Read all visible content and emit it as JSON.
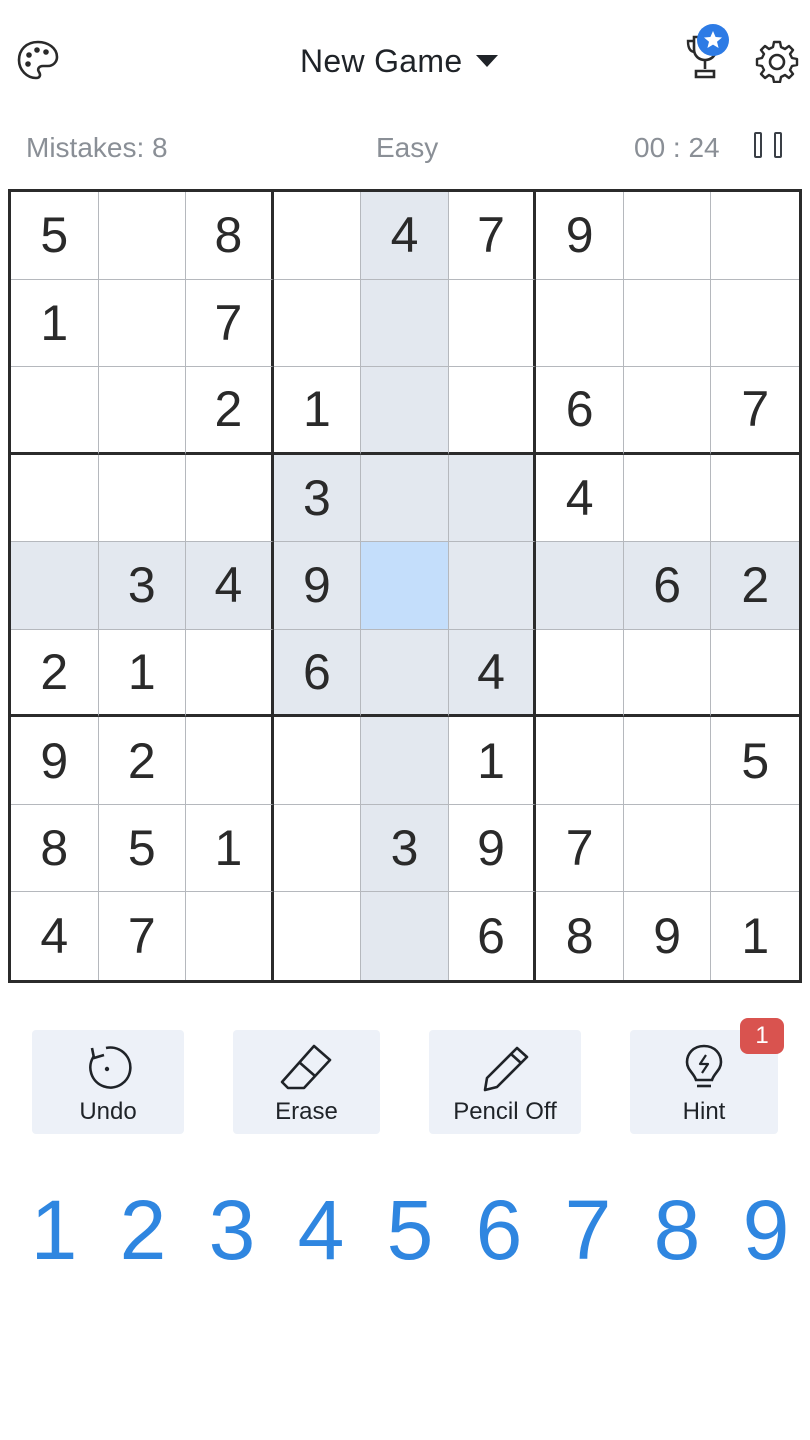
{
  "header": {
    "title": "New Game",
    "icons": [
      "palette-icon",
      "trophy-icon",
      "star-icon",
      "gear-icon"
    ],
    "accent_color": "#2d7be5"
  },
  "status": {
    "mistakes": "Mistakes: 8",
    "difficulty": "Easy",
    "timer": "00 : 24"
  },
  "board": {
    "rows": [
      [
        "5",
        "",
        "8",
        "",
        "4",
        "7",
        "9",
        "",
        ""
      ],
      [
        "1",
        "",
        "7",
        "",
        "",
        "",
        "",
        "",
        ""
      ],
      [
        "",
        "",
        "2",
        "1",
        "",
        "",
        "6",
        "",
        "7"
      ],
      [
        "",
        "",
        "",
        "3",
        "",
        "",
        "4",
        "",
        ""
      ],
      [
        "",
        "3",
        "4",
        "9",
        "",
        "",
        "",
        "6",
        "2"
      ],
      [
        "2",
        "1",
        "",
        "6",
        "",
        "4",
        "",
        "",
        ""
      ],
      [
        "9",
        "2",
        "",
        "",
        "",
        "1",
        "",
        "",
        "5"
      ],
      [
        "8",
        "5",
        "1",
        "",
        "3",
        "9",
        "7",
        "",
        ""
      ],
      [
        "4",
        "7",
        "",
        "",
        "",
        "6",
        "8",
        "9",
        "1"
      ]
    ],
    "selected": {
      "row": 5,
      "col": 5
    },
    "highlight_color": "#e3e8ef",
    "selected_color": "#c4defb"
  },
  "tools": {
    "undo": "Undo",
    "erase": "Erase",
    "pencil": "Pencil Off",
    "hint": "Hint",
    "hint_count": "1"
  },
  "numpad": [
    "1",
    "2",
    "3",
    "4",
    "5",
    "6",
    "7",
    "8",
    "9"
  ],
  "numpad_color": "#2f86e0"
}
